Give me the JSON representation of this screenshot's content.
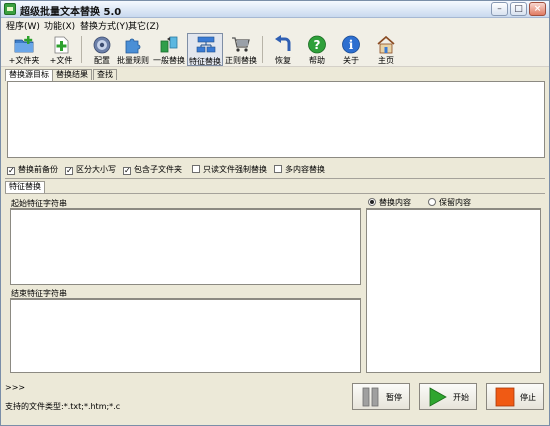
{
  "window": {
    "title": "超级批量文本替换 5.0"
  },
  "menu": [
    "程序(W)",
    "功能(X)",
    "替换方式(Y)",
    "其它(Z)"
  ],
  "toolbar": [
    {
      "label": "+文件夹",
      "icon": "folder-add-icon"
    },
    {
      "label": "+文件",
      "icon": "file-add-icon"
    },
    {
      "label": "配置",
      "icon": "settings-icon"
    },
    {
      "label": "批量规则",
      "icon": "puzzle-icon"
    },
    {
      "label": "一般替换",
      "icon": "replace-icon"
    },
    {
      "label": "特征替换",
      "icon": "feature-replace-icon"
    },
    {
      "label": "正则替换",
      "icon": "cart-icon"
    },
    {
      "label": "恢复",
      "icon": "restore-icon"
    },
    {
      "label": "帮助",
      "icon": "help-icon"
    },
    {
      "label": "关于",
      "icon": "info-icon"
    },
    {
      "label": "主页",
      "icon": "home-icon"
    }
  ],
  "top_tabs": [
    "替换源目标",
    "替换结果",
    "查找"
  ],
  "options": [
    {
      "label": "替换前备份",
      "checked": true
    },
    {
      "label": "区分大小写",
      "checked": true
    },
    {
      "label": "包含子文件夹",
      "checked": true
    },
    {
      "label": "只读文件强制替换",
      "checked": false
    },
    {
      "label": "多内容替换",
      "checked": false
    }
  ],
  "feature_tab": "特征替换",
  "start_label": "起始特征字符串",
  "end_label": "结束特征字符串",
  "radio": [
    {
      "label": "替换内容",
      "selected": true
    },
    {
      "label": "保留内容",
      "selected": false
    }
  ],
  "prompt": ">>>",
  "status": "支持的文件类型:*.txt;*.htm;*.c",
  "buttons": {
    "pause": "暂停",
    "start": "开始",
    "stop": "停止"
  },
  "colors": {
    "start_arrow": "#2fa52f",
    "stop_square": "#f05a14",
    "pause_bars": "#9a9a9a"
  }
}
